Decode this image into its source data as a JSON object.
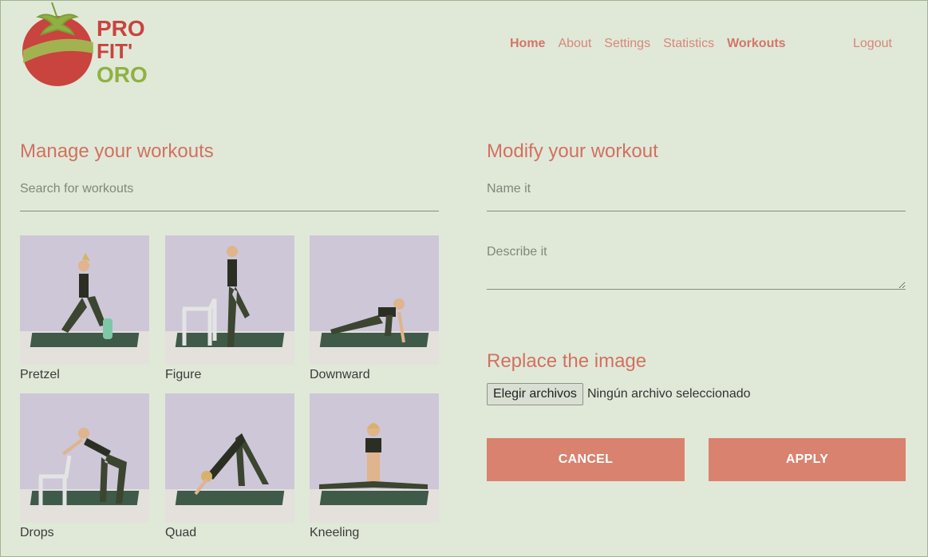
{
  "brand": {
    "logo_lines": [
      "PRO",
      "FIT'",
      "ORO"
    ],
    "colors": {
      "red": "#c9433f",
      "green": "#8fb142"
    }
  },
  "nav": {
    "items": [
      {
        "label": "Home",
        "bold": true
      },
      {
        "label": "About",
        "bold": false
      },
      {
        "label": "Settings",
        "bold": false
      },
      {
        "label": "Statistics",
        "bold": false
      },
      {
        "label": "Workouts",
        "bold": true
      }
    ],
    "logout": "Logout"
  },
  "left": {
    "title": "Manage your workouts",
    "search_placeholder": "Search for workouts",
    "workouts": [
      {
        "label": "Pretzel",
        "pose": "kneel-lunge-icon"
      },
      {
        "label": "Figure",
        "pose": "standing-quad-icon"
      },
      {
        "label": "Downward",
        "pose": "lunge-low-icon"
      },
      {
        "label": "Drops",
        "pose": "chair-bend-icon"
      },
      {
        "label": "Quad",
        "pose": "downward-dog-icon"
      },
      {
        "label": "Kneeling",
        "pose": "straddle-sit-icon"
      }
    ]
  },
  "right": {
    "title": "Modify your workout",
    "name_placeholder": "Name it",
    "describe_placeholder": "Describe it",
    "replace_title": "Replace the image",
    "file_button": "Elegir archivos",
    "file_status": "Ningún archivo seleccionado",
    "cancel": "CANCEL",
    "apply": "APPLY"
  }
}
